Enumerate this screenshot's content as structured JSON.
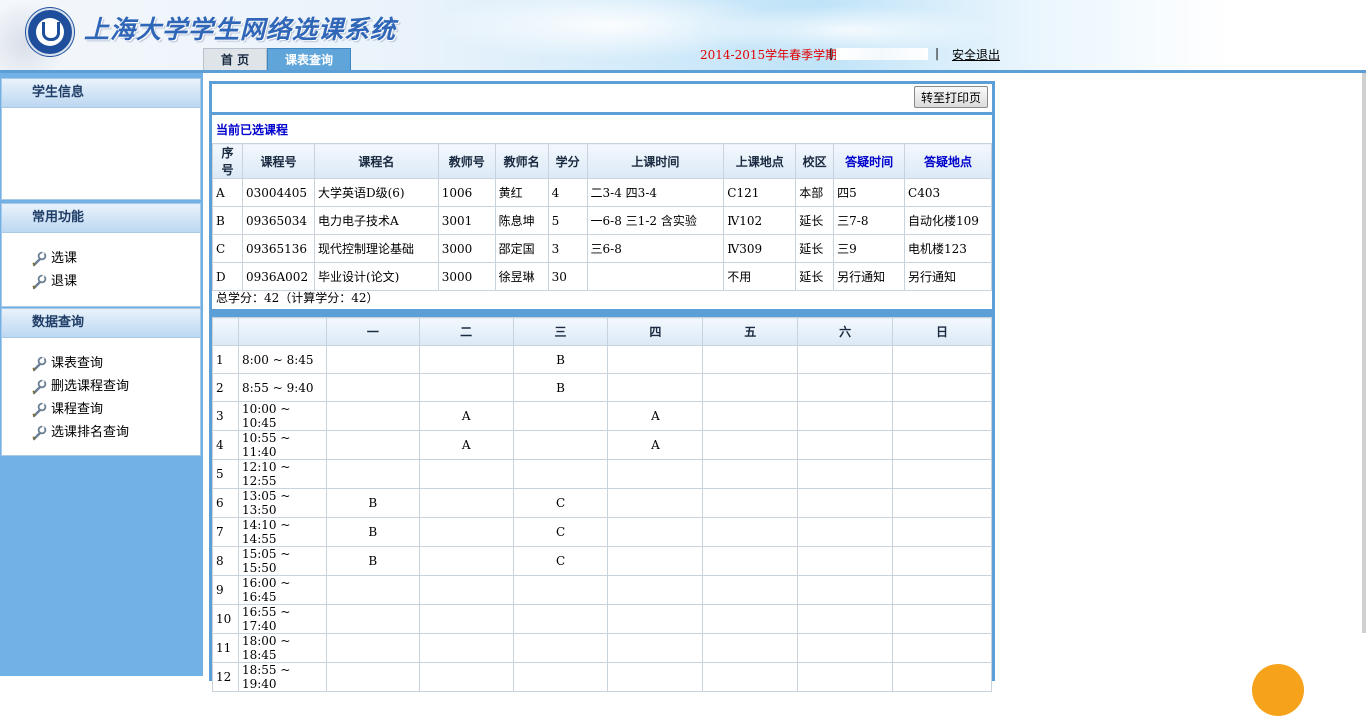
{
  "header": {
    "site_title": "上海大学学生网络选课系统",
    "tabs": [
      {
        "label": "首 页"
      },
      {
        "label": "课表查询"
      }
    ],
    "term": "2014-2015学年春季学期",
    "separator": "|",
    "logout": "安全退出"
  },
  "sidebar": {
    "student_info": {
      "title": "学生信息"
    },
    "common": {
      "title": "常用功能",
      "items": [
        {
          "label": "选课"
        },
        {
          "label": "退课"
        }
      ]
    },
    "query": {
      "title": "数据查询",
      "items": [
        {
          "label": "课表查询"
        },
        {
          "label": "删选课程查询"
        },
        {
          "label": "课程查询"
        },
        {
          "label": "选课排名查询"
        }
      ]
    }
  },
  "main": {
    "print_button": "转至打印页",
    "selected_title": "当前已选课程",
    "course_headers": [
      "序号",
      "课程号",
      "课程名",
      "教师号",
      "教师名",
      "学分",
      "上课时间",
      "上课地点",
      "校区",
      "答疑时间",
      "答疑地点"
    ],
    "courses": [
      [
        "A",
        "03004405",
        "大学英语D级(6)",
        "1006",
        "黄红",
        "4",
        "二3-4 四3-4",
        "C121",
        "本部",
        "四5",
        "C403"
      ],
      [
        "B",
        "09365034",
        "电力电子技术A",
        "3001",
        "陈息坤",
        "5",
        "一6-8 三1-2 含实验",
        "Ⅳ102",
        "延长",
        "三7-8",
        "自动化楼109"
      ],
      [
        "C",
        "09365136",
        "现代控制理论基础",
        "3000",
        "邵定国",
        "3",
        "三6-8",
        "Ⅳ309",
        "延长",
        "三9",
        "电机楼123"
      ],
      [
        "D",
        "0936A002",
        "毕业设计(论文)",
        "3000",
        "徐昱琳",
        "30",
        "",
        "不用",
        "延长",
        "另行通知",
        "另行通知"
      ]
    ],
    "total_credits": "总学分：42（计算学分：42）",
    "timetable": {
      "days": [
        "一",
        "二",
        "三",
        "四",
        "五",
        "六",
        "日"
      ],
      "rows": [
        {
          "no": "1",
          "time": "8:00 ~ 8:45",
          "cells": [
            "",
            "",
            "B",
            "",
            "",
            "",
            ""
          ]
        },
        {
          "no": "2",
          "time": "8:55 ~ 9:40",
          "cells": [
            "",
            "",
            "B",
            "",
            "",
            "",
            ""
          ]
        },
        {
          "no": "3",
          "time": "10:00 ~ 10:45",
          "cells": [
            "",
            "A",
            "",
            "A",
            "",
            "",
            ""
          ]
        },
        {
          "no": "4",
          "time": "10:55 ~ 11:40",
          "cells": [
            "",
            "A",
            "",
            "A",
            "",
            "",
            ""
          ]
        },
        {
          "no": "5",
          "time": "12:10 ~ 12:55",
          "cells": [
            "",
            "",
            "",
            "",
            "",
            "",
            ""
          ]
        },
        {
          "no": "6",
          "time": "13:05 ~ 13:50",
          "cells": [
            "B",
            "",
            "C",
            "",
            "",
            "",
            ""
          ]
        },
        {
          "no": "7",
          "time": "14:10 ~ 14:55",
          "cells": [
            "B",
            "",
            "C",
            "",
            "",
            "",
            ""
          ]
        },
        {
          "no": "8",
          "time": "15:05 ~ 15:50",
          "cells": [
            "B",
            "",
            "C",
            "",
            "",
            "",
            ""
          ]
        },
        {
          "no": "9",
          "time": "16:00 ~ 16:45",
          "cells": [
            "",
            "",
            "",
            "",
            "",
            "",
            ""
          ]
        },
        {
          "no": "10",
          "time": "16:55 ~ 17:40",
          "cells": [
            "",
            "",
            "",
            "",
            "",
            "",
            ""
          ]
        },
        {
          "no": "11",
          "time": "18:00 ~ 18:45",
          "cells": [
            "",
            "",
            "",
            "",
            "",
            "",
            ""
          ]
        },
        {
          "no": "12",
          "time": "18:55 ~ 19:40",
          "cells": [
            "",
            "",
            "",
            "",
            "",
            "",
            ""
          ]
        }
      ]
    }
  },
  "colors": {
    "term_red": "#e00000",
    "link_blue": "#0000cc",
    "sidebar_blue": "#71b1e5",
    "accent_blue": "#5c9fd6"
  },
  "icons": {
    "menu_item": "wrench-icon",
    "logo": "university-emblem-icon"
  }
}
